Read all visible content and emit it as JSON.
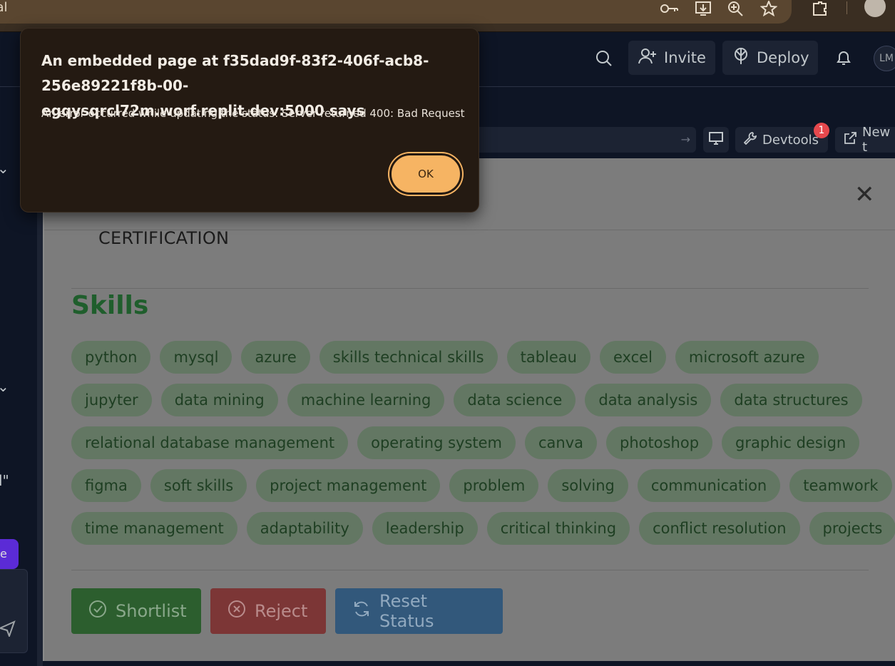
{
  "browser": {
    "omnibox_text": "rtal"
  },
  "header": {
    "invite_label": "Invite",
    "deploy_label": "Deploy",
    "avatar_initials": "LM"
  },
  "devtools": {
    "devtools_label": "Devtools",
    "badge_count": "1",
    "new_tab_label": "New t"
  },
  "left": {
    "quote_glyph": "l\"",
    "pill_text": "e"
  },
  "modal": {
    "certification_label": "CERTIFICATION",
    "skills_title": "Skills",
    "skill_rows": [
      [
        "python",
        "mysql",
        "azure",
        "skills technical skills",
        "tableau",
        "excel",
        "microsoft azure"
      ],
      [
        "jupyter",
        "data mining",
        "machine learning",
        "data science",
        "data analysis",
        "data structures"
      ],
      [
        "relational database management",
        "operating system",
        "canva",
        "photoshop",
        "graphic design"
      ],
      [
        "figma",
        "soft skills",
        "project management",
        "problem",
        "solving",
        "communication",
        "teamwork"
      ],
      [
        "time management",
        "adaptability",
        "leadership",
        "critical thinking",
        "conflict resolution",
        "projects"
      ]
    ],
    "shortlist_label": "Shortlist",
    "reject_label": "Reject",
    "reset_label": "Reset Status"
  },
  "alert": {
    "title": "An embedded page at f35dad9f-83f2-406f-acb8-256e89221f8b-00-egqysqrcl72m.worf.replit.dev:5000 says",
    "message": "An error occurred while updating the status: Server returned 400: Bad Request",
    "ok_label": "OK"
  }
}
